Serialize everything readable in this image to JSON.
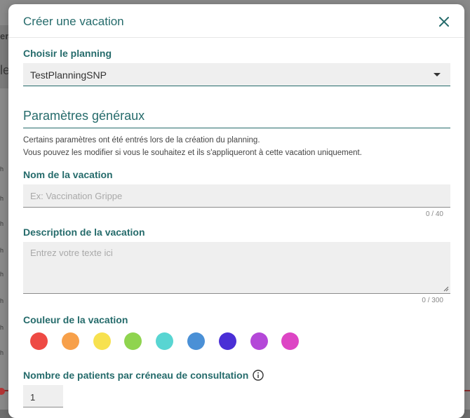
{
  "background": {
    "fragment_top": "er",
    "fragment_mid": "le",
    "hour_marks": [
      "h",
      "h",
      "h",
      "h",
      "h",
      "h",
      "h",
      "h"
    ]
  },
  "modal": {
    "title": "Créer une vacation",
    "close_icon": "close-icon"
  },
  "planning": {
    "label": "Choisir le planning",
    "selected": "TestPlanningSNP"
  },
  "general": {
    "title": "Paramètres généraux",
    "desc_line1": "Certains paramètres ont été entrés lors de la création du planning.",
    "desc_line2": "Vous pouvez les modifier si vous le souhaitez et ils s'appliqueront à cette vacation uniquement."
  },
  "name_field": {
    "label": "Nom de la vacation",
    "placeholder": "Ex: Vaccination Grippe",
    "counter": "0 / 40"
  },
  "description_field": {
    "label": "Description de la vacation",
    "placeholder": "Entrez votre texte ici",
    "counter": "0 / 300"
  },
  "color_field": {
    "label": "Couleur de la vacation",
    "colors": [
      "#ee4a44",
      "#f7a04a",
      "#f7e14f",
      "#8fd44f",
      "#58d5d2",
      "#4a90d6",
      "#4a2fd6",
      "#b448d8",
      "#dd45c4"
    ]
  },
  "patients_field": {
    "label": "Nombre de patients par créneau de consultation",
    "value": "1"
  },
  "colors": {
    "accent": "#256b6b"
  }
}
